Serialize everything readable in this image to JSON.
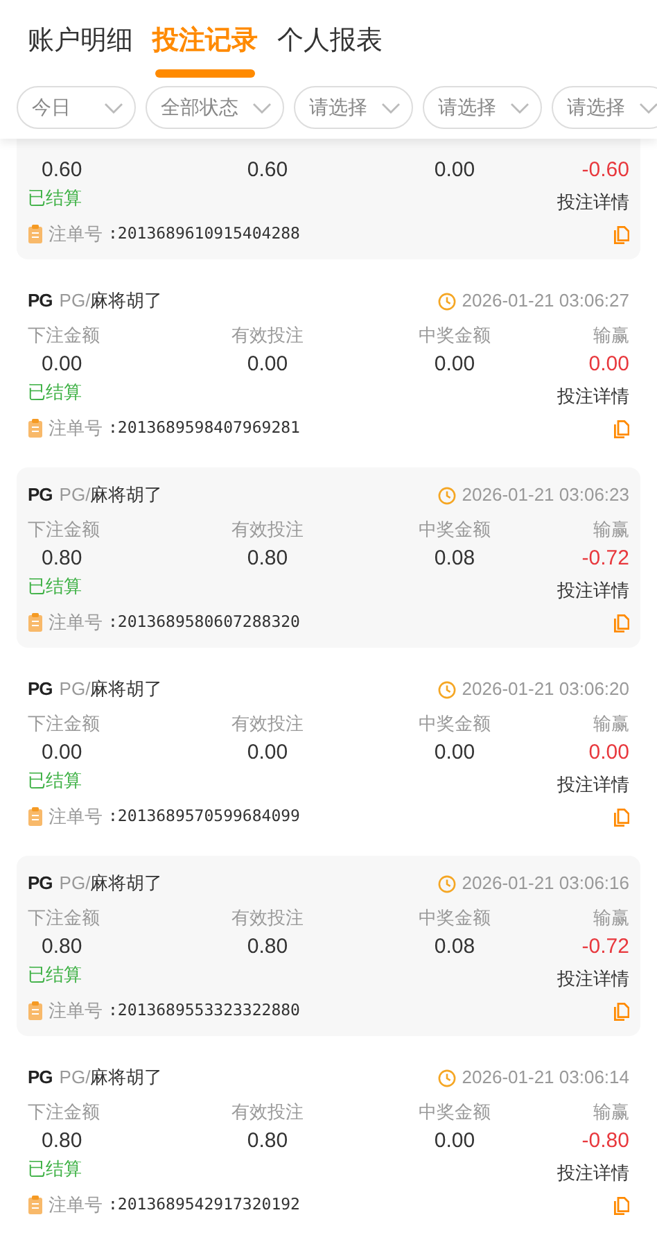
{
  "tabs": [
    {
      "label": "账户明细",
      "selected": false
    },
    {
      "label": "投注记录",
      "selected": true
    },
    {
      "label": "个人报表",
      "selected": false
    }
  ],
  "filters": [
    "今日",
    "全部状态",
    "请选择",
    "请选择",
    "请选择"
  ],
  "bets": [
    {
      "values": [
        "0.60",
        "0.60",
        "0.00",
        "-0.60"
      ],
      "status": "已结算",
      "detail": "投注详情",
      "order_label": "注单号",
      "order_no": ":2013689610915404288"
    },
    {
      "logo": "PG",
      "provider": "PG/",
      "game": "麻将胡了",
      "time": "2026-01-21 03:06:27",
      "labels": [
        "下注金额",
        "有效投注",
        "中奖金额",
        "输赢"
      ],
      "values": [
        "0.00",
        "0.00",
        "0.00",
        "0.00"
      ],
      "status": "已结算",
      "detail": "投注详情",
      "order_label": "注单号",
      "order_no": ":2013689598407969281"
    },
    {
      "logo": "PG",
      "provider": "PG/",
      "game": "麻将胡了",
      "time": "2026-01-21 03:06:23",
      "labels": [
        "下注金额",
        "有效投注",
        "中奖金额",
        "输赢"
      ],
      "values": [
        "0.80",
        "0.80",
        "0.08",
        "-0.72"
      ],
      "status": "已结算",
      "detail": "投注详情",
      "order_label": "注单号",
      "order_no": ":2013689580607288320"
    },
    {
      "logo": "PG",
      "provider": "PG/",
      "game": "麻将胡了",
      "time": "2026-01-21 03:06:20",
      "labels": [
        "下注金额",
        "有效投注",
        "中奖金额",
        "输赢"
      ],
      "values": [
        "0.00",
        "0.00",
        "0.00",
        "0.00"
      ],
      "status": "已结算",
      "detail": "投注详情",
      "order_label": "注单号",
      "order_no": ":2013689570599684099"
    },
    {
      "logo": "PG",
      "provider": "PG/",
      "game": "麻将胡了",
      "time": "2026-01-21 03:06:16",
      "labels": [
        "下注金额",
        "有效投注",
        "中奖金额",
        "输赢"
      ],
      "values": [
        "0.80",
        "0.80",
        "0.08",
        "-0.72"
      ],
      "status": "已结算",
      "detail": "投注详情",
      "order_label": "注单号",
      "order_no": ":2013689553323322880"
    },
    {
      "logo": "PG",
      "provider": "PG/",
      "game": "麻将胡了",
      "time": "2026-01-21 03:06:14",
      "labels": [
        "下注金额",
        "有效投注",
        "中奖金额",
        "输赢"
      ],
      "values": [
        "0.80",
        "0.80",
        "0.00",
        "-0.80"
      ],
      "status": "已结算",
      "detail": "投注详情",
      "order_label": "注单号",
      "order_no": ":2013689542917320192"
    }
  ]
}
